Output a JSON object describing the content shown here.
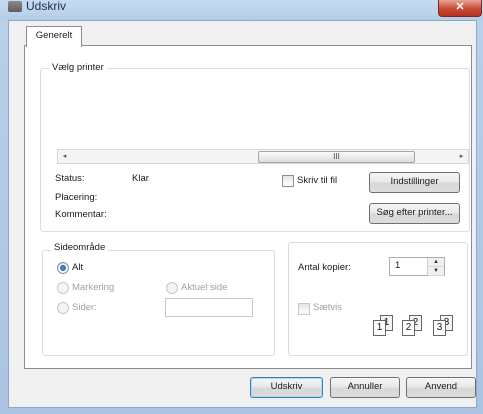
{
  "window": {
    "title": "Udskriv",
    "close_glyph": "✕"
  },
  "tabs": [
    {
      "label": "Generelt"
    }
  ],
  "printer_group": {
    "legend": "Vælg printer",
    "scroll_left_glyph": "◂",
    "scroll_right_glyph": "▸",
    "scroll_thumb_glyph": "III",
    "status_label": "Status:",
    "status_value": "Klar",
    "location_label": "Placering:",
    "comment_label": "Kommentar:",
    "print_to_file_label": "Skriv til fil",
    "settings_button": "Indstillinger",
    "find_printer_button": "Søg efter printer..."
  },
  "range_group": {
    "legend": "Sideområde",
    "all_label": "Alt",
    "selection_label": "Markering",
    "current_page_label": "Aktuel side",
    "pages_label": "Sider:",
    "pages_value": ""
  },
  "copies_group": {
    "copies_label": "Antal kopier:",
    "copies_value": "1",
    "collate_label": "Sætvis",
    "collate_pages": [
      "1",
      "1",
      "2",
      "2",
      "3",
      "3"
    ]
  },
  "buttons": {
    "print": "Udskriv",
    "cancel": "Annuller",
    "apply": "Anvend"
  }
}
